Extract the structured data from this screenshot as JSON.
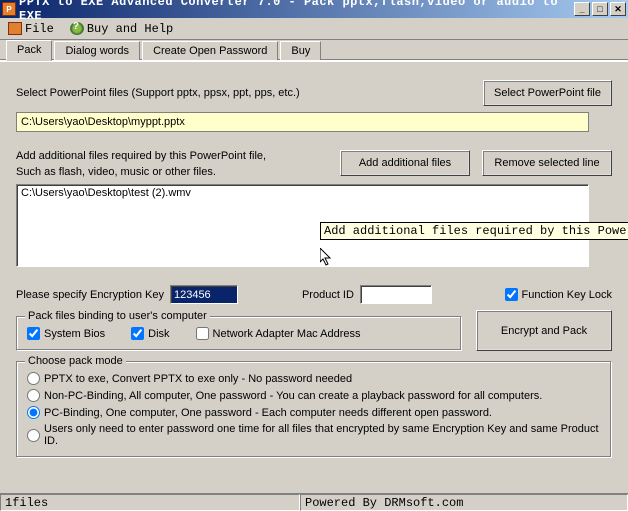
{
  "title": "PPTX to EXE Advanced Converter 7.0 - Pack pptx,flash,video or audio to EXE",
  "menu": {
    "file": "File",
    "buyhelp": "Buy and Help"
  },
  "tabs": {
    "pack": "Pack",
    "dialog": "Dialog words",
    "createpw": "Create Open Password",
    "buy": "Buy"
  },
  "selectLabel": "Select PowerPoint files (Support pptx, ppsx, ppt, pps,  etc.)",
  "selectBtn": "Select PowerPoint file",
  "pptPath": "C:\\Users\\yao\\Desktop\\myppt.pptx",
  "addLabel1": "Add additional files required by this PowerPoint file,",
  "addLabel2": "Such as flash, video, music or other files.",
  "addBtn": "Add additional files",
  "removeBtn": "Remove selected line",
  "additionalFile": "C:\\Users\\yao\\Desktop\\test (2).wmv",
  "tooltip": "Add additional files required by this PowerPoint fil",
  "encLabel": "Please specify Encryption Key",
  "encKey": "123456",
  "pidLabel": "Product ID",
  "pidValue": "",
  "funcLock": "Function Key Lock",
  "binding": {
    "legend": "Pack files binding to user's computer",
    "sysbios": "System Bios",
    "disk": "Disk",
    "netmac": "Network Adapter Mac Address"
  },
  "encryptBtn": "Encrypt and Pack",
  "mode": {
    "legend": "Choose pack mode",
    "opt1": "PPTX to exe, Convert PPTX to exe only - No password needed",
    "opt2": "Non-PC-Binding, All computer, One password  - You can create a playback password for all computers.",
    "opt3": "PC-Binding, One computer, One password  - Each computer needs different open password.",
    "opt4": "Users only need to enter password one time for all files that encrypted by same Encryption Key and same Product ID."
  },
  "status": {
    "left": "1files",
    "right": "Powered By DRMsoft.com"
  }
}
